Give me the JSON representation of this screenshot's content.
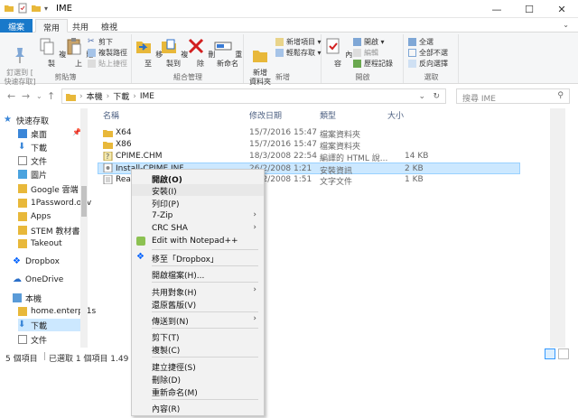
{
  "window": {
    "title": "IME",
    "minimize": "—",
    "maximize": "☐",
    "close": "✕"
  },
  "ribbon_tabs": [
    "檔案",
    "常用",
    "共用",
    "檢視"
  ],
  "ribbon": {
    "clipboard": {
      "label": "剪貼簿",
      "pin": "釘選到 [\n快速存取]",
      "copy": "複製",
      "paste": "貼上",
      "cut": "剪下",
      "copy_path": "複製路徑",
      "paste_shortcut": "貼上捷徑"
    },
    "organize": {
      "label": "組合管理",
      "move_to": "移至",
      "copy_to": "複製到",
      "delete": "刪除",
      "rename": "重新命名"
    },
    "new": {
      "label": "新增",
      "new_folder": "新增\n資料夾",
      "new_item": "新增項目 ▾",
      "easy_access": "輕鬆存取 ▾"
    },
    "open": {
      "label": "開啟",
      "properties": "內容",
      "open": "開啟 ▾",
      "edit": "編輯",
      "history": "歷程記錄"
    },
    "select": {
      "label": "選取",
      "select_all": "全選",
      "select_none": "全部不選",
      "invert": "反向選擇"
    }
  },
  "address": {
    "crumbs": [
      "本機",
      "下載",
      "IME"
    ],
    "search_placeholder": "搜尋 IME"
  },
  "nav": {
    "items": [
      {
        "label": "快速存取",
        "icon": "star-icon"
      },
      {
        "label": "桌面",
        "icon": "desktop-icon"
      },
      {
        "label": "下載",
        "icon": "download-icon"
      },
      {
        "label": "文件",
        "icon": "document-icon"
      },
      {
        "label": "圖片",
        "icon": "picture-icon"
      },
      {
        "label": "Google 雲端",
        "icon": "folder-icon"
      },
      {
        "label": "1Password.opv",
        "icon": "folder-icon"
      },
      {
        "label": "Apps",
        "icon": "folder-icon"
      },
      {
        "label": "STEM 教材書",
        "icon": "folder-icon"
      },
      {
        "label": "Takeout",
        "icon": "folder-icon"
      },
      {
        "label": "Dropbox",
        "icon": "dropbox-icon"
      },
      {
        "label": "OneDrive",
        "icon": "cloud-icon"
      },
      {
        "label": "本機",
        "icon": "computer-icon"
      },
      {
        "label": "home.enterpr1s",
        "icon": "folder-icon"
      },
      {
        "label": "下載",
        "icon": "download-icon"
      },
      {
        "label": "文件",
        "icon": "document-icon"
      }
    ]
  },
  "columns": [
    "名稱",
    "修改日期",
    "類型",
    "大小"
  ],
  "files": [
    {
      "name": "X64",
      "date": "15/7/2016 15:47",
      "type": "檔案資料夾",
      "size": ""
    },
    {
      "name": "X86",
      "date": "15/7/2016 15:47",
      "type": "檔案資料夾",
      "size": ""
    },
    {
      "name": "CPIME.CHM",
      "date": "18/3/2008 22:54",
      "type": "編譯的 HTML 說...",
      "size": "14 KB"
    },
    {
      "name": "Install-CPIME.INF",
      "date": "26/2/2008 1:21",
      "type": "安裝資訊",
      "size": "2 KB"
    },
    {
      "name": "Read",
      "date": "26/2/2008 1:51",
      "type": "文字文件",
      "size": "1 KB"
    }
  ],
  "status": {
    "count": "5 個項目",
    "selected": "已選取 1 個項目  1.49 KB"
  },
  "context_menu": {
    "open": "開啟(O)",
    "install": "安裝(I)",
    "print": "列印(P)",
    "zip": "7-Zip",
    "crc": "CRC SHA",
    "notepad": "Edit with Notepad++",
    "dropbox": "移至「Dropbox」",
    "open_with": "開啟檔案(H)...",
    "share": "共用對象(H)",
    "restore": "還原舊版(V)",
    "send_to": "傳送到(N)",
    "cut": "剪下(T)",
    "copy": "複製(C)",
    "shortcut": "建立捷徑(S)",
    "delete": "刪除(D)",
    "rename": "重新命名(M)",
    "properties": "內容(R)"
  },
  "colors": {
    "accent": "#1979ca",
    "selection": "#cce8ff",
    "folder": "#e8b83a"
  }
}
